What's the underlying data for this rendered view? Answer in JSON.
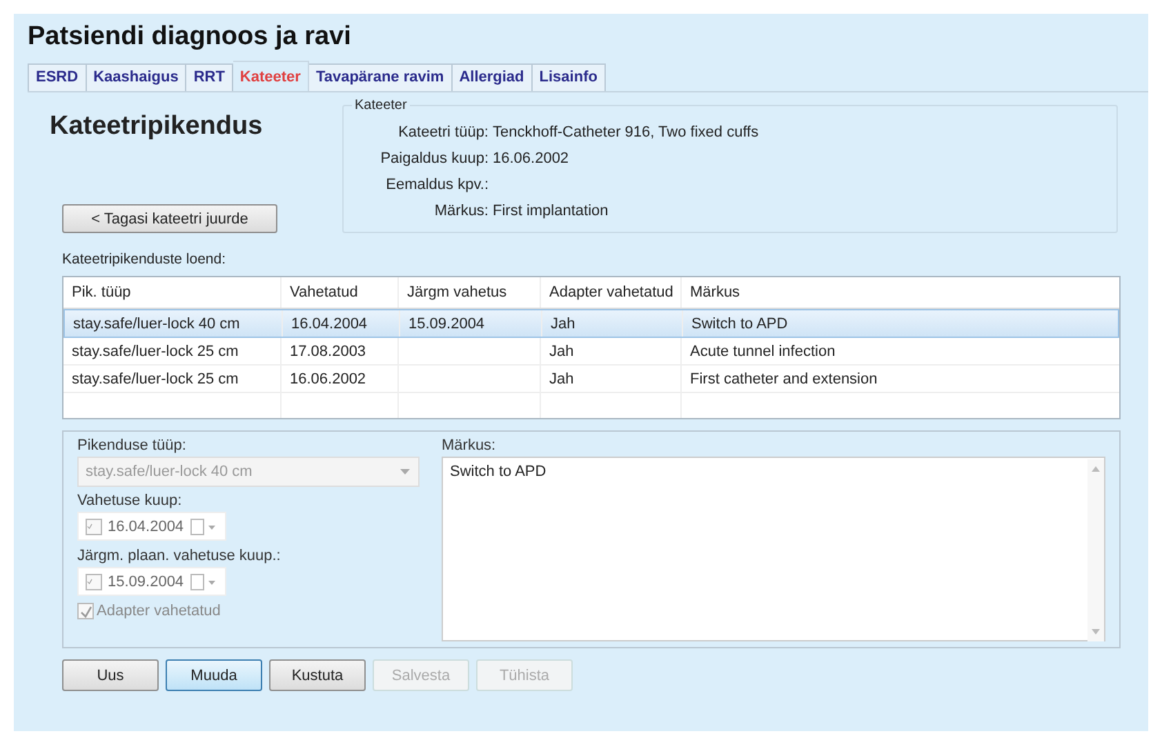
{
  "window": {
    "title": "Patsiendi diagnoos ja ravi"
  },
  "tabs": [
    {
      "label": "ESRD",
      "selected": false
    },
    {
      "label": "Kaashaigus",
      "selected": false
    },
    {
      "label": "RRT",
      "selected": false
    },
    {
      "label": "Kateeter",
      "selected": true
    },
    {
      "label": "Tavapärane ravim",
      "selected": false
    },
    {
      "label": "Allergiad",
      "selected": false
    },
    {
      "label": "Lisainfo",
      "selected": false
    }
  ],
  "heading": "Kateetripikendus",
  "back_button": "< Tagasi kateetri juurde",
  "catheter_group": {
    "legend": "Kateeter",
    "fields": [
      {
        "label": "Kateetri tüüp:",
        "value": "Tenckhoff-Catheter 916, Two fixed cuffs"
      },
      {
        "label": "Paigaldus kuup:",
        "value": "16.06.2002"
      },
      {
        "label": "Eemaldus kpv.:"
      },
      {
        "label": "Märkus:",
        "value": "First implantation"
      }
    ]
  },
  "list_label": "Kateetripikenduste loend:",
  "table": {
    "columns": [
      "Pik. tüüp",
      "Vahetatud",
      "Järgm vahetus",
      "Adapter vahetatud",
      "Märkus"
    ],
    "rows": [
      {
        "selected": true,
        "type": "stay.safe/luer-lock 40 cm",
        "changed": "16.04.2004",
        "next_change": "15.09.2004",
        "adapter_changed": "Jah",
        "remark": "Switch to APD"
      },
      {
        "selected": false,
        "type": "stay.safe/luer-lock 25 cm",
        "changed": "17.08.2003",
        "adapter_changed": "Jah",
        "remark": "Acute tunnel infection"
      },
      {
        "selected": false,
        "type": "stay.safe/luer-lock 25 cm",
        "changed": "16.06.2002",
        "adapter_changed": "Jah",
        "remark": "First catheter and extension"
      }
    ]
  },
  "form": {
    "type_field": {
      "label": "Pikenduse tüüp:",
      "value": "stay.safe/luer-lock 40 cm",
      "disabled": true
    },
    "dates": [
      {
        "label": "Vahetuse kuup:",
        "value": "16.04.2004",
        "checked": true,
        "disabled": true
      },
      {
        "label": "Järgm. plaan. vahetuse kuup.:",
        "value": "15.09.2004",
        "checked": true,
        "disabled": true
      }
    ],
    "adapter": {
      "label": "Adapter vahetatud",
      "checked": true,
      "disabled": true
    },
    "remark": {
      "label": "Märkus:",
      "value": "Switch to APD"
    }
  },
  "buttons": [
    {
      "label": "Uus",
      "default": false,
      "disabled": false
    },
    {
      "label": "Muuda",
      "default": true,
      "disabled": false
    },
    {
      "label": "Kustuta",
      "default": false,
      "disabled": false
    },
    {
      "label": "Salvesta",
      "default": false,
      "disabled": true
    },
    {
      "label": "Tühista",
      "default": false,
      "disabled": true
    }
  ]
}
